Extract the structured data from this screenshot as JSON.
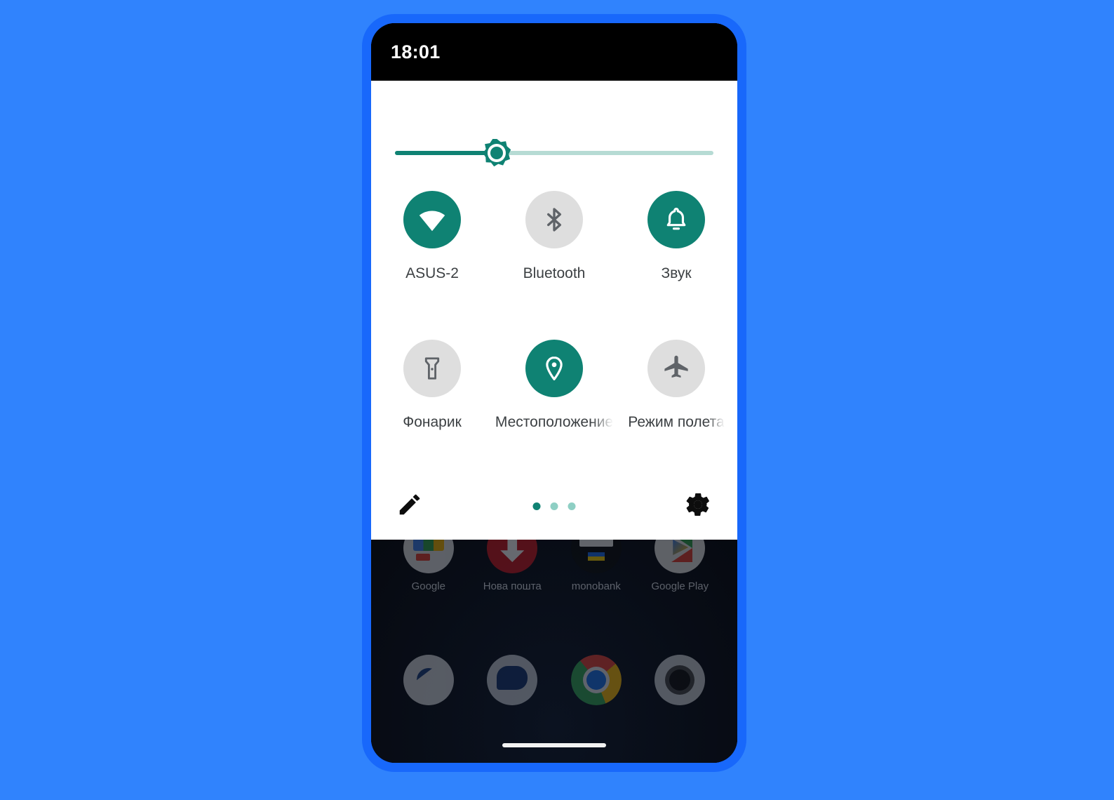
{
  "theme": {
    "background_blue": "#3083fd",
    "frame_blue": "#1868fb",
    "accent_teal": "#0f8273",
    "inactive_gray": "#dedede",
    "panel_white": "#ffffff"
  },
  "status_bar": {
    "clock": "18:01"
  },
  "quick_settings": {
    "brightness": {
      "name": "brightness-slider",
      "value_percent": 32,
      "icon": "brightness-sun-icon"
    },
    "tile_rows": [
      [
        {
          "label": "ASUS-2",
          "icon": "wifi-icon",
          "state": "on"
        },
        {
          "label": "Bluetooth",
          "icon": "bluetooth-icon",
          "state": "off"
        },
        {
          "label": "Звук",
          "icon": "bell-icon",
          "state": "on"
        }
      ],
      [
        {
          "label": "Фонарик",
          "icon": "flashlight-icon",
          "state": "off"
        },
        {
          "label": "Местоположение",
          "icon": "location-pin-icon",
          "state": "on"
        },
        {
          "label": "Режим полета",
          "icon": "airplane-icon",
          "state": "off"
        }
      ]
    ],
    "footer": {
      "edit_icon": "pencil-icon",
      "settings_icon": "gear-icon",
      "pages": 3,
      "active_page": 1
    }
  },
  "home_screen": {
    "app_row": [
      {
        "label": "Google",
        "icon": "google-icon"
      },
      {
        "label": "Нова пошта",
        "icon": "nova-poshta-icon"
      },
      {
        "label": "monobank",
        "icon": "monobank-icon"
      },
      {
        "label": "Google Play",
        "icon": "google-play-icon"
      }
    ],
    "dock": [
      {
        "label": "",
        "icon": "phone-icon"
      },
      {
        "label": "",
        "icon": "messages-icon"
      },
      {
        "label": "",
        "icon": "chrome-icon"
      },
      {
        "label": "",
        "icon": "camera-icon"
      }
    ]
  }
}
